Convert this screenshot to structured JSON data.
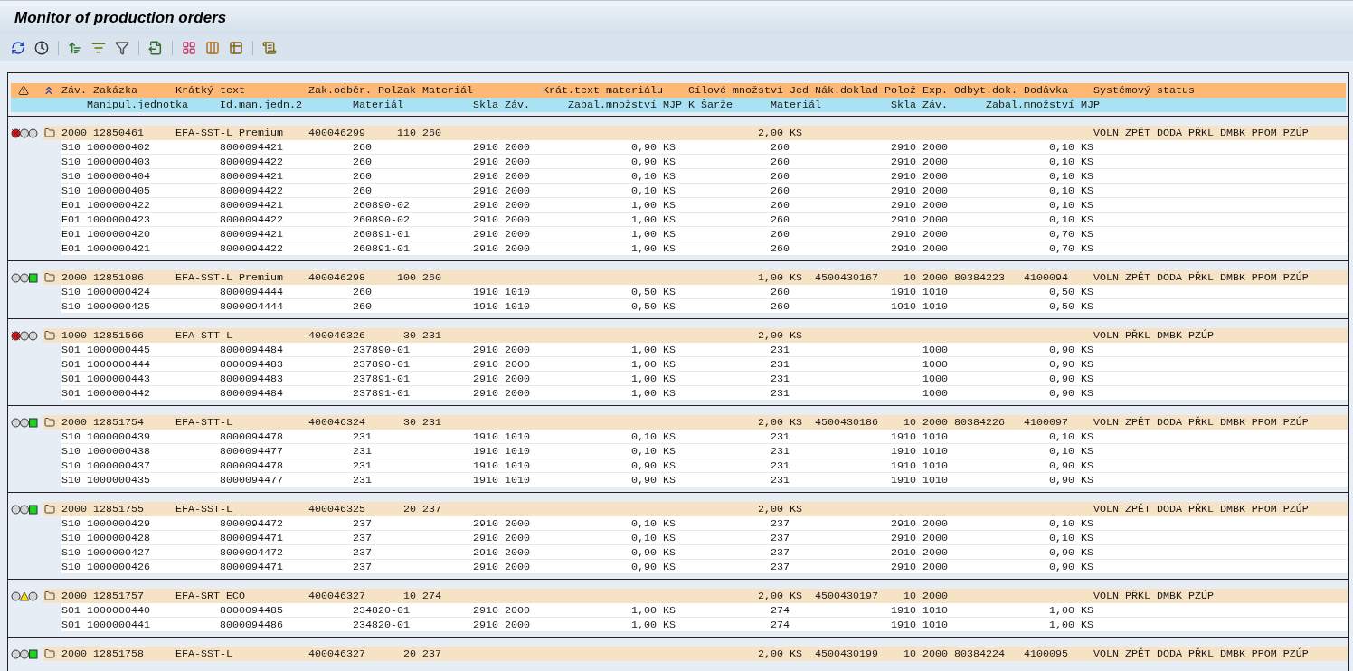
{
  "window": {
    "title": "Monitor of production orders"
  },
  "header_row_1": [
    "Záv.",
    "Zakázka",
    "Krátký text",
    "Zak.odběr.",
    "PolZak",
    "Materiál",
    "Krát.text materiálu",
    "Cílové množství",
    "Jed",
    "Nák.doklad",
    "Polož",
    "Exp.",
    "Odbyt.dok.",
    "Dodávka",
    "Systémový status"
  ],
  "header_row_2": [
    "Manipul.jednotka",
    "Id.man.jedn.2",
    "Materiál",
    "Skla",
    "Záv.",
    "Zabal.množství",
    "MJP",
    "K",
    "Šarže",
    "Materiál",
    "Skla",
    "Záv.",
    "Zabal.množství",
    "MJP"
  ],
  "orders": [
    {
      "kind": "red",
      "zav": "2000",
      "zakazka": "12850461",
      "kratky_text": "EFA-SST-L Premium",
      "zak_odber": "400046299",
      "pol_zak": "110",
      "material": "260",
      "cilove_mnozstvi": "2,00",
      "jed": "KS",
      "systemovy_status": "VOLN ZPĚT DODA PŘKL DMBK PPOM PZÚP",
      "units": [
        {
          "typ": "S10",
          "manipul": "1000000402",
          "id_man": "8000094421",
          "material": "260",
          "skla": "2910",
          "zav": "2000",
          "zabal": "0,90",
          "mjp": "KS",
          "material_2": "260",
          "skla_2": "2910",
          "zav_2": "2000",
          "zabal_2": "0,10",
          "mjp_2": "KS"
        },
        {
          "typ": "S10",
          "manipul": "1000000403",
          "id_man": "8000094422",
          "material": "260",
          "skla": "2910",
          "zav": "2000",
          "zabal": "0,90",
          "mjp": "KS",
          "material_2": "260",
          "skla_2": "2910",
          "zav_2": "2000",
          "zabal_2": "0,10",
          "mjp_2": "KS"
        },
        {
          "typ": "S10",
          "manipul": "1000000404",
          "id_man": "8000094421",
          "material": "260",
          "skla": "2910",
          "zav": "2000",
          "zabal": "0,10",
          "mjp": "KS",
          "material_2": "260",
          "skla_2": "2910",
          "zav_2": "2000",
          "zabal_2": "0,10",
          "mjp_2": "KS"
        },
        {
          "typ": "S10",
          "manipul": "1000000405",
          "id_man": "8000094422",
          "material": "260",
          "skla": "2910",
          "zav": "2000",
          "zabal": "0,10",
          "mjp": "KS",
          "material_2": "260",
          "skla_2": "2910",
          "zav_2": "2000",
          "zabal_2": "0,10",
          "mjp_2": "KS"
        },
        {
          "typ": "E01",
          "manipul": "1000000422",
          "id_man": "8000094421",
          "material": "260890-02",
          "skla": "2910",
          "zav": "2000",
          "zabal": "1,00",
          "mjp": "KS",
          "material_2": "260",
          "skla_2": "2910",
          "zav_2": "2000",
          "zabal_2": "0,10",
          "mjp_2": "KS"
        },
        {
          "typ": "E01",
          "manipul": "1000000423",
          "id_man": "8000094422",
          "material": "260890-02",
          "skla": "2910",
          "zav": "2000",
          "zabal": "1,00",
          "mjp": "KS",
          "material_2": "260",
          "skla_2": "2910",
          "zav_2": "2000",
          "zabal_2": "0,10",
          "mjp_2": "KS"
        },
        {
          "typ": "E01",
          "manipul": "1000000420",
          "id_man": "8000094421",
          "material": "260891-01",
          "skla": "2910",
          "zav": "2000",
          "zabal": "1,00",
          "mjp": "KS",
          "material_2": "260",
          "skla_2": "2910",
          "zav_2": "2000",
          "zabal_2": "0,70",
          "mjp_2": "KS"
        },
        {
          "typ": "E01",
          "manipul": "1000000421",
          "id_man": "8000094422",
          "material": "260891-01",
          "skla": "2910",
          "zav": "2000",
          "zabal": "1,00",
          "mjp": "KS",
          "material_2": "260",
          "skla_2": "2910",
          "zav_2": "2000",
          "zabal_2": "0,70",
          "mjp_2": "KS"
        }
      ]
    },
    {
      "kind": "green",
      "zav": "2000",
      "zakazka": "12851086",
      "kratky_text": "EFA-SST-L Premium",
      "zak_odber": "400046298",
      "pol_zak": "100",
      "material": "260",
      "cilove_mnozstvi": "1,00",
      "jed": "KS",
      "nak_doklad": "4500430167",
      "poloz": "10",
      "exp": "2000",
      "odbyt_dok": "80384223",
      "dodavka": "4100094",
      "systemovy_status": "VOLN ZPĚT DODA PŘKL DMBK PPOM PZÚP",
      "units": [
        {
          "typ": "S10",
          "manipul": "1000000424",
          "id_man": "8000094444",
          "material": "260",
          "skla": "1910",
          "zav": "1010",
          "zabal": "0,50",
          "mjp": "KS",
          "material_2": "260",
          "skla_2": "1910",
          "zav_2": "1010",
          "zabal_2": "0,50",
          "mjp_2": "KS"
        },
        {
          "typ": "S10",
          "manipul": "1000000425",
          "id_man": "8000094444",
          "material": "260",
          "skla": "1910",
          "zav": "1010",
          "zabal": "0,50",
          "mjp": "KS",
          "material_2": "260",
          "skla_2": "1910",
          "zav_2": "1010",
          "zabal_2": "0,50",
          "mjp_2": "KS"
        }
      ]
    },
    {
      "kind": "red",
      "zav": "1000",
      "zakazka": "12851566",
      "kratky_text": "EFA-STT-L",
      "zak_odber": "400046326",
      "pol_zak": "30",
      "material": "231",
      "cilove_mnozstvi": "2,00",
      "jed": "KS",
      "systemovy_status": "VOLN PŘKL DMBK PZÚP",
      "units": [
        {
          "typ": "S01",
          "manipul": "1000000445",
          "id_man": "8000094484",
          "material": "237890-01",
          "skla": "2910",
          "zav": "2000",
          "zabal": "1,00",
          "mjp": "KS",
          "material_2": "231",
          "zav_2": "1000",
          "zabal_2": "0,90",
          "mjp_2": "KS"
        },
        {
          "typ": "S01",
          "manipul": "1000000444",
          "id_man": "8000094483",
          "material": "237890-01",
          "skla": "2910",
          "zav": "2000",
          "zabal": "1,00",
          "mjp": "KS",
          "material_2": "231",
          "zav_2": "1000",
          "zabal_2": "0,90",
          "mjp_2": "KS"
        },
        {
          "typ": "S01",
          "manipul": "1000000443",
          "id_man": "8000094483",
          "material": "237891-01",
          "skla": "2910",
          "zav": "2000",
          "zabal": "1,00",
          "mjp": "KS",
          "material_2": "231",
          "zav_2": "1000",
          "zabal_2": "0,90",
          "mjp_2": "KS"
        },
        {
          "typ": "S01",
          "manipul": "1000000442",
          "id_man": "8000094484",
          "material": "237891-01",
          "skla": "2910",
          "zav": "2000",
          "zabal": "1,00",
          "mjp": "KS",
          "material_2": "231",
          "zav_2": "1000",
          "zabal_2": "0,90",
          "mjp_2": "KS"
        }
      ]
    },
    {
      "kind": "green",
      "zav": "2000",
      "zakazka": "12851754",
      "kratky_text": "EFA-STT-L",
      "zak_odber": "400046324",
      "pol_zak": "30",
      "material": "231",
      "cilove_mnozstvi": "2,00",
      "jed": "KS",
      "nak_doklad": "4500430186",
      "poloz": "10",
      "exp": "2000",
      "odbyt_dok": "80384226",
      "dodavka": "4100097",
      "systemovy_status": "VOLN ZPĚT DODA PŘKL DMBK PPOM PZÚP",
      "units": [
        {
          "typ": "S10",
          "manipul": "1000000439",
          "id_man": "8000094478",
          "material": "231",
          "skla": "1910",
          "zav": "1010",
          "zabal": "0,10",
          "mjp": "KS",
          "material_2": "231",
          "skla_2": "1910",
          "zav_2": "1010",
          "zabal_2": "0,10",
          "mjp_2": "KS"
        },
        {
          "typ": "S10",
          "manipul": "1000000438",
          "id_man": "8000094477",
          "material": "231",
          "skla": "1910",
          "zav": "1010",
          "zabal": "0,10",
          "mjp": "KS",
          "material_2": "231",
          "skla_2": "1910",
          "zav_2": "1010",
          "zabal_2": "0,10",
          "mjp_2": "KS"
        },
        {
          "typ": "S10",
          "manipul": "1000000437",
          "id_man": "8000094478",
          "material": "231",
          "skla": "1910",
          "zav": "1010",
          "zabal": "0,90",
          "mjp": "KS",
          "material_2": "231",
          "skla_2": "1910",
          "zav_2": "1010",
          "zabal_2": "0,90",
          "mjp_2": "KS"
        },
        {
          "typ": "S10",
          "manipul": "1000000435",
          "id_man": "8000094477",
          "material": "231",
          "skla": "1910",
          "zav": "1010",
          "zabal": "0,90",
          "mjp": "KS",
          "material_2": "231",
          "skla_2": "1910",
          "zav_2": "1010",
          "zabal_2": "0,90",
          "mjp_2": "KS"
        }
      ]
    },
    {
      "kind": "green",
      "zav": "2000",
      "zakazka": "12851755",
      "kratky_text": "EFA-SST-L",
      "zak_odber": "400046325",
      "pol_zak": "20",
      "material": "237",
      "cilove_mnozstvi": "2,00",
      "jed": "KS",
      "systemovy_status": "VOLN ZPĚT DODA PŘKL DMBK PPOM PZÚP",
      "units": [
        {
          "typ": "S10",
          "manipul": "1000000429",
          "id_man": "8000094472",
          "material": "237",
          "skla": "2910",
          "zav": "2000",
          "zabal": "0,10",
          "mjp": "KS",
          "material_2": "237",
          "skla_2": "2910",
          "zav_2": "2000",
          "zabal_2": "0,10",
          "mjp_2": "KS"
        },
        {
          "typ": "S10",
          "manipul": "1000000428",
          "id_man": "8000094471",
          "material": "237",
          "skla": "2910",
          "zav": "2000",
          "zabal": "0,10",
          "mjp": "KS",
          "material_2": "237",
          "skla_2": "2910",
          "zav_2": "2000",
          "zabal_2": "0,10",
          "mjp_2": "KS"
        },
        {
          "typ": "S10",
          "manipul": "1000000427",
          "id_man": "8000094472",
          "material": "237",
          "skla": "2910",
          "zav": "2000",
          "zabal": "0,90",
          "mjp": "KS",
          "material_2": "237",
          "skla_2": "2910",
          "zav_2": "2000",
          "zabal_2": "0,90",
          "mjp_2": "KS"
        },
        {
          "typ": "S10",
          "manipul": "1000000426",
          "id_man": "8000094471",
          "material": "237",
          "skla": "2910",
          "zav": "2000",
          "zabal": "0,90",
          "mjp": "KS",
          "material_2": "237",
          "skla_2": "2910",
          "zav_2": "2000",
          "zabal_2": "0,90",
          "mjp_2": "KS"
        }
      ]
    },
    {
      "kind": "yellow",
      "zav": "2000",
      "zakazka": "12851757",
      "kratky_text": "EFA-SRT ECO",
      "zak_odber": "400046327",
      "pol_zak": "10",
      "material": "274",
      "cilove_mnozstvi": "2,00",
      "jed": "KS",
      "nak_doklad": "4500430197",
      "poloz": "10",
      "exp": "2000",
      "systemovy_status": "VOLN PŘKL DMBK PZÚP",
      "units": [
        {
          "typ": "S01",
          "manipul": "1000000440",
          "id_man": "8000094485",
          "material": "234820-01",
          "skla": "2910",
          "zav": "2000",
          "zabal": "1,00",
          "mjp": "KS",
          "material_2": "274",
          "skla_2": "1910",
          "zav_2": "1010",
          "zabal_2": "1,00",
          "mjp_2": "KS"
        },
        {
          "typ": "S01",
          "manipul": "1000000441",
          "id_man": "8000094486",
          "material": "234820-01",
          "skla": "2910",
          "zav": "2000",
          "zabal": "1,00",
          "mjp": "KS",
          "material_2": "274",
          "skla_2": "1910",
          "zav_2": "1010",
          "zabal_2": "1,00",
          "mjp_2": "KS"
        }
      ]
    },
    {
      "kind": "green",
      "zav": "2000",
      "zakazka": "12851758",
      "kratky_text": "EFA-SST-L",
      "zak_odber": "400046327",
      "pol_zak": "20",
      "material": "237",
      "cilove_mnozstvi": "2,00",
      "jed": "KS",
      "nak_doklad": "4500430199",
      "poloz": "10",
      "exp": "2000",
      "odbyt_dok": "80384224",
      "dodavka": "4100095",
      "systemovy_status": "VOLN ZPĚT DODA PŘKL DMBK PPOM PZÚP"
    }
  ]
}
